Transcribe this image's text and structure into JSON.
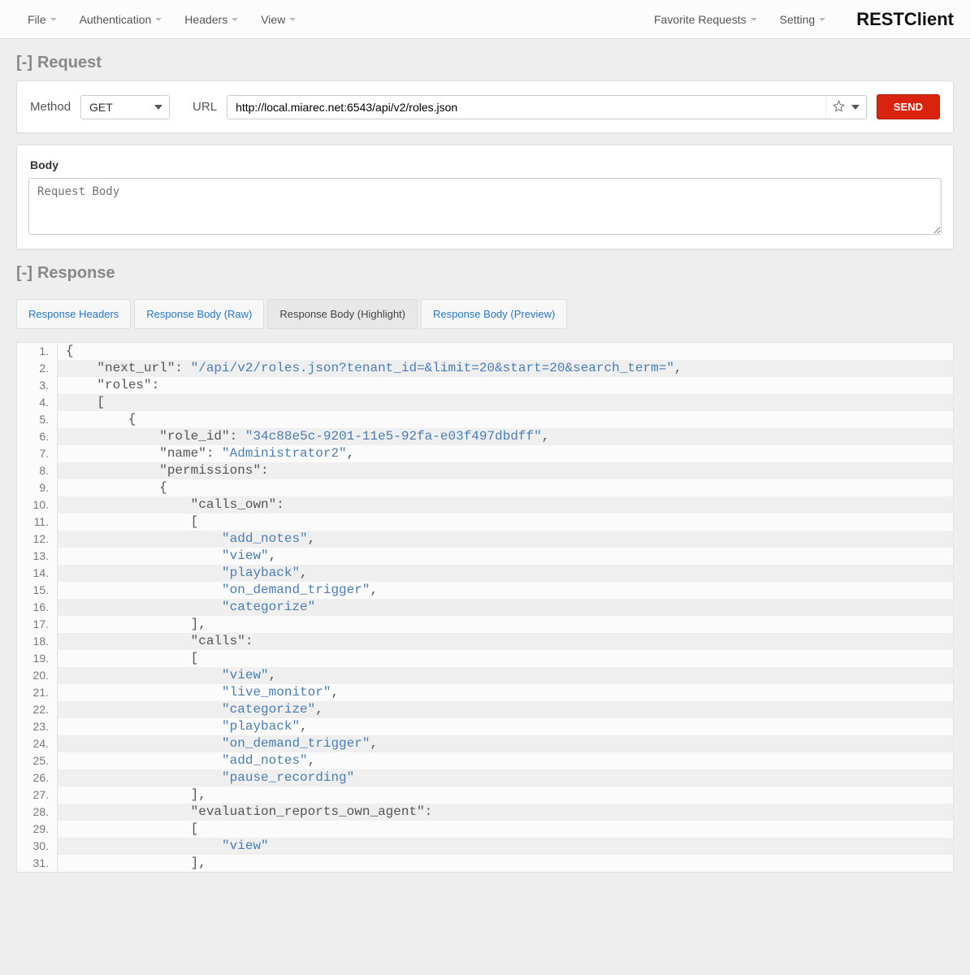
{
  "toolbar": {
    "menus": [
      "File",
      "Authentication",
      "Headers",
      "View"
    ],
    "right_menus": [
      "Favorite Requests",
      "Setting"
    ],
    "brand": "RESTClient"
  },
  "request": {
    "toggle": "[-]",
    "title": "Request",
    "method_label": "Method",
    "method_value": "GET",
    "url_label": "URL",
    "url_value": "http://local.miarec.net:6543/api/v2/roles.json",
    "send_label": "SEND",
    "body_label": "Body",
    "body_placeholder": "Request Body"
  },
  "response": {
    "toggle": "[-]",
    "title": "Response",
    "tabs": [
      "Response Headers",
      "Response Body (Raw)",
      "Response Body (Highlight)",
      "Response Body (Preview)"
    ],
    "active_tab": 2,
    "code_lines": [
      [
        {
          "t": "punc",
          "v": "{"
        }
      ],
      [
        {
          "t": "key",
          "v": "    \"next_url\""
        },
        {
          "t": "punc",
          "v": ": "
        },
        {
          "t": "str",
          "v": "\"/api/v2/roles.json?tenant_id=&limit=20&start=20&search_term=\""
        },
        {
          "t": "punc",
          "v": ","
        }
      ],
      [
        {
          "t": "key",
          "v": "    \"roles\""
        },
        {
          "t": "punc",
          "v": ":"
        }
      ],
      [
        {
          "t": "punc",
          "v": "    ["
        }
      ],
      [
        {
          "t": "punc",
          "v": "        {"
        }
      ],
      [
        {
          "t": "key",
          "v": "            \"role_id\""
        },
        {
          "t": "punc",
          "v": ": "
        },
        {
          "t": "str",
          "v": "\"34c88e5c-9201-11e5-92fa-e03f497dbdff\""
        },
        {
          "t": "punc",
          "v": ","
        }
      ],
      [
        {
          "t": "key",
          "v": "            \"name\""
        },
        {
          "t": "punc",
          "v": ": "
        },
        {
          "t": "str",
          "v": "\"Administrator2\""
        },
        {
          "t": "punc",
          "v": ","
        }
      ],
      [
        {
          "t": "key",
          "v": "            \"permissions\""
        },
        {
          "t": "punc",
          "v": ":"
        }
      ],
      [
        {
          "t": "punc",
          "v": "            {"
        }
      ],
      [
        {
          "t": "key",
          "v": "                \"calls_own\""
        },
        {
          "t": "punc",
          "v": ":"
        }
      ],
      [
        {
          "t": "punc",
          "v": "                ["
        }
      ],
      [
        {
          "t": "punc",
          "v": "                    "
        },
        {
          "t": "str",
          "v": "\"add_notes\""
        },
        {
          "t": "punc",
          "v": ","
        }
      ],
      [
        {
          "t": "punc",
          "v": "                    "
        },
        {
          "t": "str",
          "v": "\"view\""
        },
        {
          "t": "punc",
          "v": ","
        }
      ],
      [
        {
          "t": "punc",
          "v": "                    "
        },
        {
          "t": "str",
          "v": "\"playback\""
        },
        {
          "t": "punc",
          "v": ","
        }
      ],
      [
        {
          "t": "punc",
          "v": "                    "
        },
        {
          "t": "str",
          "v": "\"on_demand_trigger\""
        },
        {
          "t": "punc",
          "v": ","
        }
      ],
      [
        {
          "t": "punc",
          "v": "                    "
        },
        {
          "t": "str",
          "v": "\"categorize\""
        }
      ],
      [
        {
          "t": "punc",
          "v": "                ],"
        }
      ],
      [
        {
          "t": "key",
          "v": "                \"calls\""
        },
        {
          "t": "punc",
          "v": ":"
        }
      ],
      [
        {
          "t": "punc",
          "v": "                ["
        }
      ],
      [
        {
          "t": "punc",
          "v": "                    "
        },
        {
          "t": "str",
          "v": "\"view\""
        },
        {
          "t": "punc",
          "v": ","
        }
      ],
      [
        {
          "t": "punc",
          "v": "                    "
        },
        {
          "t": "str",
          "v": "\"live_monitor\""
        },
        {
          "t": "punc",
          "v": ","
        }
      ],
      [
        {
          "t": "punc",
          "v": "                    "
        },
        {
          "t": "str",
          "v": "\"categorize\""
        },
        {
          "t": "punc",
          "v": ","
        }
      ],
      [
        {
          "t": "punc",
          "v": "                    "
        },
        {
          "t": "str",
          "v": "\"playback\""
        },
        {
          "t": "punc",
          "v": ","
        }
      ],
      [
        {
          "t": "punc",
          "v": "                    "
        },
        {
          "t": "str",
          "v": "\"on_demand_trigger\""
        },
        {
          "t": "punc",
          "v": ","
        }
      ],
      [
        {
          "t": "punc",
          "v": "                    "
        },
        {
          "t": "str",
          "v": "\"add_notes\""
        },
        {
          "t": "punc",
          "v": ","
        }
      ],
      [
        {
          "t": "punc",
          "v": "                    "
        },
        {
          "t": "str",
          "v": "\"pause_recording\""
        }
      ],
      [
        {
          "t": "punc",
          "v": "                ],"
        }
      ],
      [
        {
          "t": "key",
          "v": "                \"evaluation_reports_own_agent\""
        },
        {
          "t": "punc",
          "v": ":"
        }
      ],
      [
        {
          "t": "punc",
          "v": "                ["
        }
      ],
      [
        {
          "t": "punc",
          "v": "                    "
        },
        {
          "t": "str",
          "v": "\"view\""
        }
      ],
      [
        {
          "t": "punc",
          "v": "                ],"
        }
      ]
    ]
  }
}
